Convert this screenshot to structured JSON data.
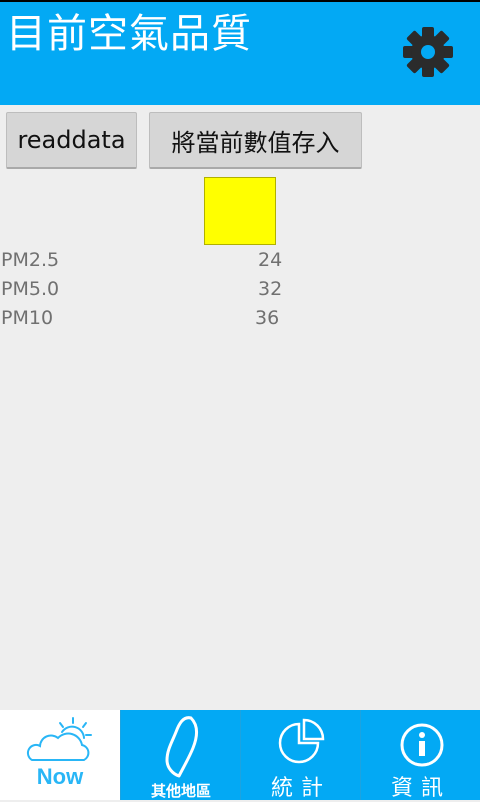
{
  "header": {
    "title": "目前空氣品質",
    "settings_icon": "gear-icon",
    "color": "#03a9f4"
  },
  "actions": {
    "read_label": "readdata",
    "save_label": "將當前數值存入"
  },
  "indicator": {
    "color": "#ffff00"
  },
  "readings": [
    {
      "label": "PM2.5",
      "value": "24"
    },
    {
      "label": "PM5.0",
      "value": "32"
    },
    {
      "label": "PM10",
      "value": "36"
    }
  ],
  "tabs": [
    {
      "label": "Now",
      "icon": "weather-cloud-sun-icon",
      "active": true
    },
    {
      "label": "其他地區",
      "icon": "taiwan-map-icon",
      "active": false
    },
    {
      "label": "統計",
      "icon": "pie-chart-icon",
      "active": false
    },
    {
      "label": "資訊",
      "icon": "info-icon",
      "active": false
    }
  ]
}
